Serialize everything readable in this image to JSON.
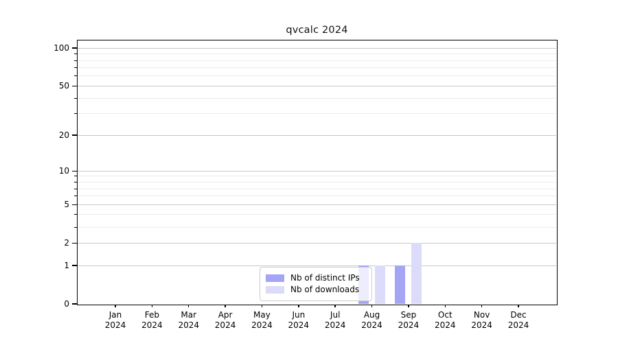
{
  "chart_data": {
    "type": "bar",
    "title": "qvcalc 2024",
    "year": "2024",
    "categories": [
      "Jan",
      "Feb",
      "Mar",
      "Apr",
      "May",
      "Jun",
      "Jul",
      "Aug",
      "Sep",
      "Oct",
      "Nov",
      "Dec"
    ],
    "series": [
      {
        "name": "Nb of distinct IPs",
        "color": "#a5a5f6",
        "values": [
          0,
          0,
          0,
          0,
          0,
          0,
          0,
          1,
          1,
          0,
          0,
          0
        ]
      },
      {
        "name": "Nb of downloads",
        "color": "#dcdcfa",
        "values": [
          0,
          0,
          0,
          0,
          0,
          0,
          0,
          1,
          2,
          0,
          0,
          0
        ]
      }
    ],
    "y_axis": {
      "scale": "log1p",
      "major_ticks": [
        0,
        1,
        2,
        5,
        10,
        20,
        50,
        100
      ],
      "minor_ticks": [
        3,
        4,
        6,
        7,
        8,
        9,
        30,
        40,
        60,
        70,
        80,
        90
      ],
      "axis_max": 115
    },
    "x_axis": {
      "tick_label_format": "month over year"
    },
    "legend": {
      "position": "lower center"
    },
    "grid": {
      "major_color": "#c8c8c8",
      "minor_color": "#ededed"
    },
    "background": "#ffffff",
    "spine_color": "#000000"
  }
}
